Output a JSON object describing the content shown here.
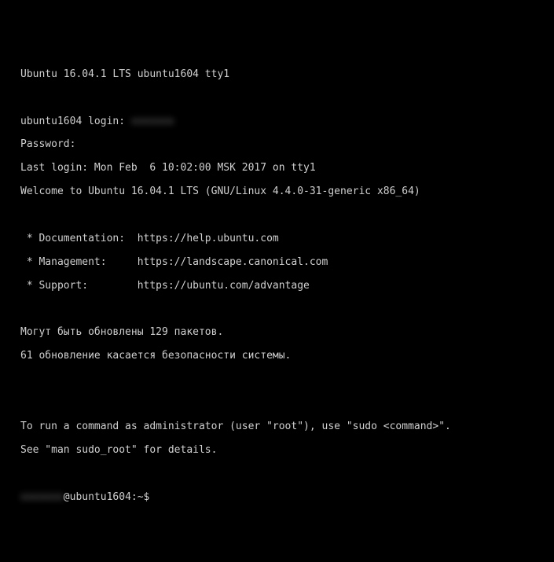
{
  "terminal": {
    "header": "Ubuntu 16.04.1 LTS ubuntu1604 tty1",
    "login_prompt": "ubuntu1604 login: ",
    "login_user_blurred": "xxxxxxx",
    "password_prompt": "Password:",
    "last_login": "Last login: Mon Feb  6 10:02:00 MSK 2017 on tty1",
    "welcome": "Welcome to Ubuntu 16.04.1 LTS (GNU/Linux 4.4.0-31-generic x86_64)",
    "doc_line": " * Documentation:  https://help.ubuntu.com",
    "mgmt_line": " * Management:     https://landscape.canonical.com",
    "support_line": " * Support:        https://ubuntu.com/advantage",
    "updates_line1": "Могут быть обновлены 129 пакетов.",
    "updates_line2": "61 обновление касается безопасности системы.",
    "sudo_line1": "To run a command as administrator (user \"root\"), use \"sudo <command>\".",
    "sudo_line2": "See \"man sudo_root\" for details.",
    "prompt_user_blurred": "xxxxxxx",
    "prompt_tail": "@ubuntu1604:~$"
  }
}
